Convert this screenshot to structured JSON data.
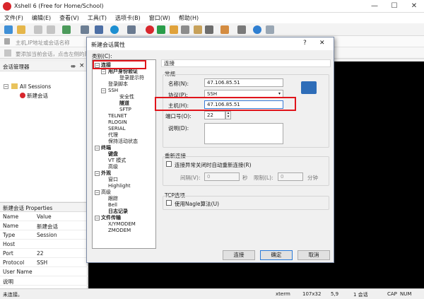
{
  "app": {
    "title": "Xshell 6 (Free for Home/School)",
    "minimize": "—",
    "maximize": "☐",
    "close": "✕",
    "brand_color": "#d8262c"
  },
  "menu": [
    "文件(F)",
    "编辑(E)",
    "查看(V)",
    "工具(T)",
    "选项卡(B)",
    "窗口(W)",
    "帮助(H)"
  ],
  "address_bar": {
    "placeholder": "主机,IP地址或会话名称"
  },
  "tip_bar": {
    "text": "要添加当前会话，点击左侧的箭头按钮。"
  },
  "session_manager": {
    "title": "会话管理器",
    "pin": "ᚒ",
    "close": "×",
    "tree": [
      {
        "label": "All Sessions"
      },
      {
        "label": "新建会话"
      }
    ]
  },
  "properties": {
    "title": "新建会话 Properties",
    "header_name": "Name",
    "header_value": "Value",
    "rows": [
      {
        "name": "Name",
        "value": "新建会话"
      },
      {
        "name": "Type",
        "value": "Session"
      },
      {
        "name": "Host",
        "value": ""
      },
      {
        "name": "Port",
        "value": "22"
      },
      {
        "name": "Protocol",
        "value": "SSH"
      },
      {
        "name": "User Name",
        "value": ""
      },
      {
        "name": "说明",
        "value": ""
      }
    ]
  },
  "status_bar": {
    "left": "未连接。",
    "term": "xterm",
    "size": "107x32",
    "pos": "5,9",
    "sessions": "1 会话",
    "cap": "CAP",
    "num": "NUM"
  },
  "dialog": {
    "title": "新建会话属性",
    "help": "?",
    "close": "✕",
    "category_label": "类别(C):",
    "tree": [
      {
        "label": "连接",
        "bold": true,
        "exp": "−"
      },
      {
        "label": "用户身份验证",
        "bold": true,
        "exp": "−"
      },
      {
        "label": "登录提示符",
        "bold": false,
        "exp": ""
      },
      {
        "label": "登录脚本",
        "bold": false,
        "exp": ""
      },
      {
        "label": "SSH",
        "bold": false,
        "exp": "−"
      },
      {
        "label": "安全性",
        "bold": false,
        "exp": ""
      },
      {
        "label": "隧道",
        "bold": true,
        "exp": ""
      },
      {
        "label": "SFTP",
        "bold": false,
        "exp": ""
      },
      {
        "label": "TELNET",
        "bold": false,
        "exp": ""
      },
      {
        "label": "RLOGIN",
        "bold": false,
        "exp": ""
      },
      {
        "label": "SERIAL",
        "bold": false,
        "exp": ""
      },
      {
        "label": "代理",
        "bold": false,
        "exp": ""
      },
      {
        "label": "保持活动状态",
        "bold": false,
        "exp": ""
      },
      {
        "label": "终端",
        "bold": true,
        "exp": "−"
      },
      {
        "label": "键盘",
        "bold": true,
        "exp": ""
      },
      {
        "label": "VT 模式",
        "bold": false,
        "exp": ""
      },
      {
        "label": "高级",
        "bold": false,
        "exp": ""
      },
      {
        "label": "外观",
        "bold": true,
        "exp": "−"
      },
      {
        "label": "窗口",
        "bold": false,
        "exp": ""
      },
      {
        "label": "Highlight",
        "bold": false,
        "exp": ""
      },
      {
        "label": "高级",
        "bold": false,
        "exp": "−"
      },
      {
        "label": "跟踪",
        "bold": false,
        "exp": ""
      },
      {
        "label": "Bell",
        "bold": false,
        "exp": ""
      },
      {
        "label": "日志记录",
        "bold": true,
        "exp": ""
      },
      {
        "label": "文件传输",
        "bold": true,
        "exp": "−"
      },
      {
        "label": "X/YMODEM",
        "bold": false,
        "exp": ""
      },
      {
        "label": "ZMODEM",
        "bold": false,
        "exp": ""
      }
    ],
    "panel_header": "连接",
    "general_label": "常规",
    "name_label": "名称(N):",
    "name_value": "47.106.85.51",
    "protocol_label": "协议(P):",
    "protocol_value": "SSH",
    "host_label": "主机(H):",
    "host_value": "47.106.85.51",
    "port_label": "端口号(O):",
    "port_value": "22",
    "desc_label": "说明(D):",
    "reconnect_label": "重新连接",
    "reconnect_check": "连接异常关闭时自动重新连接(R)",
    "interval_label": "间隔(V):",
    "interval_value": "0",
    "seconds": "秒",
    "limit_label": "限制(L):",
    "limit_value": "0",
    "minutes": "分钟",
    "tcp_label": "TCP选项",
    "nagle_check": "使用Nagle算法(U)",
    "btn_connect": "连接",
    "btn_ok": "确定",
    "btn_cancel": "取消",
    "highlight_color": "#e0141b"
  }
}
